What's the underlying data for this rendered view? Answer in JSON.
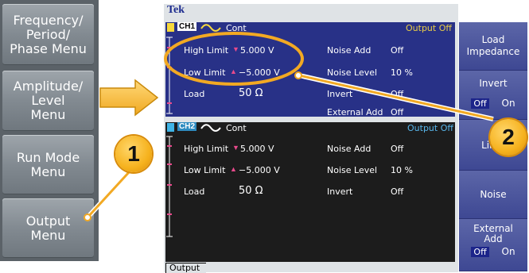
{
  "left_menu": [
    {
      "label": "Frequency/\nPeriod/\nPhase Menu"
    },
    {
      "label": "Amplitude/\nLevel\nMenu"
    },
    {
      "label": "Run Mode\nMenu"
    },
    {
      "label": "Output\nMenu"
    }
  ],
  "brand": "Tek",
  "ch1": {
    "name": "CH1",
    "mode": "Cont",
    "status": "Output Off",
    "high_limit_label": "High Limit",
    "high_limit_value": "5.000 V",
    "low_limit_label": "Low Limit",
    "low_limit_value": "−5.000 V",
    "load_label": "Load",
    "load_value": "50 Ω",
    "noise_add_label": "Noise Add",
    "noise_add_value": "Off",
    "noise_level_label": "Noise Level",
    "noise_level_value": "10 %",
    "invert_label": "Invert",
    "invert_value": "Off",
    "external_add_label": "External Add",
    "external_add_value": "Off"
  },
  "ch2": {
    "name": "CH2",
    "mode": "Cont",
    "status": "Output Off",
    "high_limit_label": "High Limit",
    "high_limit_value": "5.000 V",
    "low_limit_label": "Low Limit",
    "low_limit_value": "−5.000 V",
    "load_label": "Load",
    "load_value": "50 Ω",
    "noise_add_label": "Noise Add",
    "noise_add_value": "Off",
    "noise_level_label": "Noise Level",
    "noise_level_value": "10 %",
    "invert_label": "Invert",
    "invert_value": "Off"
  },
  "tab_label": "Output",
  "right_menu": {
    "load_impedance": "Load\nImpedance",
    "invert": "Invert",
    "invert_off": "Off",
    "invert_on": "On",
    "limit": "Limit",
    "noise": "Noise",
    "external_add": "External\nAdd",
    "external_add_off": "Off",
    "external_add_on": "On"
  },
  "callouts": [
    "1",
    "2"
  ],
  "colors": {
    "ch1_bg": "#283187",
    "ch2_bg": "#1c1c1c",
    "output_status": "#e8cc48",
    "callout": "#f6b21e"
  }
}
